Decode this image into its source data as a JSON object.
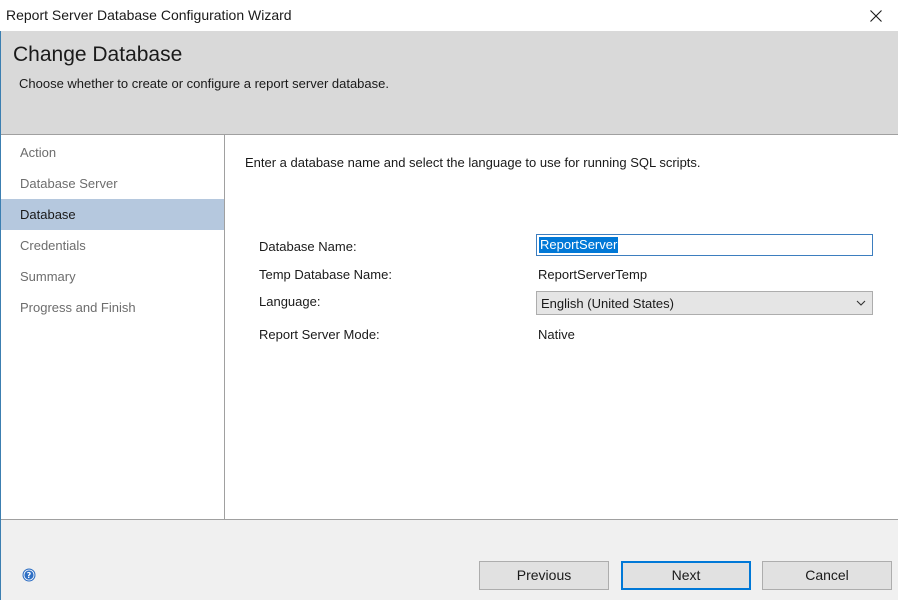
{
  "window": {
    "title": "Report Server Database Configuration Wizard",
    "close_icon": "close-icon"
  },
  "header": {
    "title": "Change Database",
    "subtitle": "Choose whether to create or configure a report server database."
  },
  "nav": {
    "items": [
      {
        "label": "Action",
        "selected": false
      },
      {
        "label": "Database Server",
        "selected": false
      },
      {
        "label": "Database",
        "selected": true
      },
      {
        "label": "Credentials",
        "selected": false
      },
      {
        "label": "Summary",
        "selected": false
      },
      {
        "label": "Progress and Finish",
        "selected": false
      }
    ]
  },
  "main": {
    "instructions": "Enter a database name and select the language to use for running SQL scripts.",
    "fields": {
      "database_name_label": "Database Name:",
      "database_name_value": "ReportServer",
      "temp_db_label": "Temp Database Name:",
      "temp_db_value": "ReportServerTemp",
      "language_label": "Language:",
      "language_value": "English (United States)",
      "mode_label": "Report Server Mode:",
      "mode_value": "Native"
    }
  },
  "footer": {
    "help_icon": "help-icon",
    "previous_label": "Previous",
    "next_label": "Next",
    "cancel_label": "Cancel"
  },
  "colors": {
    "accent": "#0078d7",
    "header_bg": "#d9d9d9",
    "nav_selected": "#b5c8de",
    "footer_bg": "#f0f0f0"
  }
}
